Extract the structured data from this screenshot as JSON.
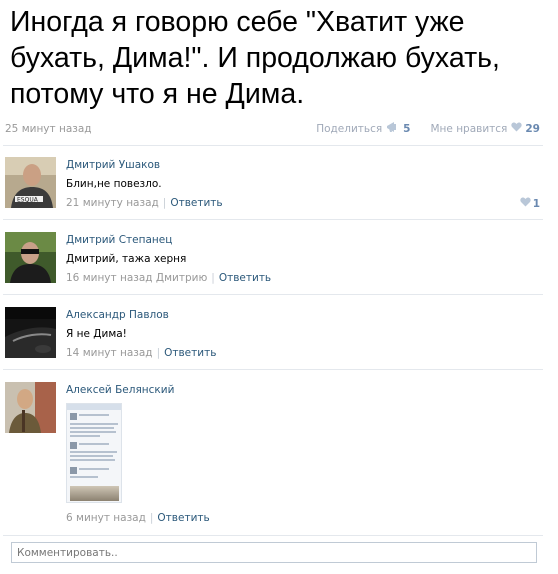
{
  "post": {
    "text": "Иногда я говорю себе \"Хватит уже бухать, Дима!\". И продолжаю бухать, потому что я не Дима.",
    "time": "25 минут назад",
    "share_label": "Поделиться",
    "share_count": "5",
    "like_label": "Мне нравится",
    "like_count": "29"
  },
  "comments": [
    {
      "author": "Дмитрий Ушаков",
      "text": "Блин,не повезло.",
      "time": "21 минуту назад",
      "reply_label": "Ответить",
      "likes": "1"
    },
    {
      "author": "Дмитрий Степанец",
      "text": "Дмитрий, тажа херня",
      "time": "16 минут назад Дмитрию",
      "reply_label": "Ответить"
    },
    {
      "author": "Александр Павлов",
      "text": "Я не Дима!",
      "time": "14 минут назад",
      "reply_label": "Ответить"
    },
    {
      "author": "Алексей Белянский",
      "text": "",
      "time": "6 минут назад",
      "reply_label": "Ответить"
    }
  ],
  "comment_input": {
    "placeholder": "Комментировать.."
  },
  "colors": {
    "link": "#2b587a",
    "muted": "#999999",
    "like_heart": "#b9c7d8",
    "border": "#c0cad5"
  },
  "icons": {
    "share": "megaphone-icon",
    "like": "heart-icon",
    "comment_like": "heart-icon"
  }
}
